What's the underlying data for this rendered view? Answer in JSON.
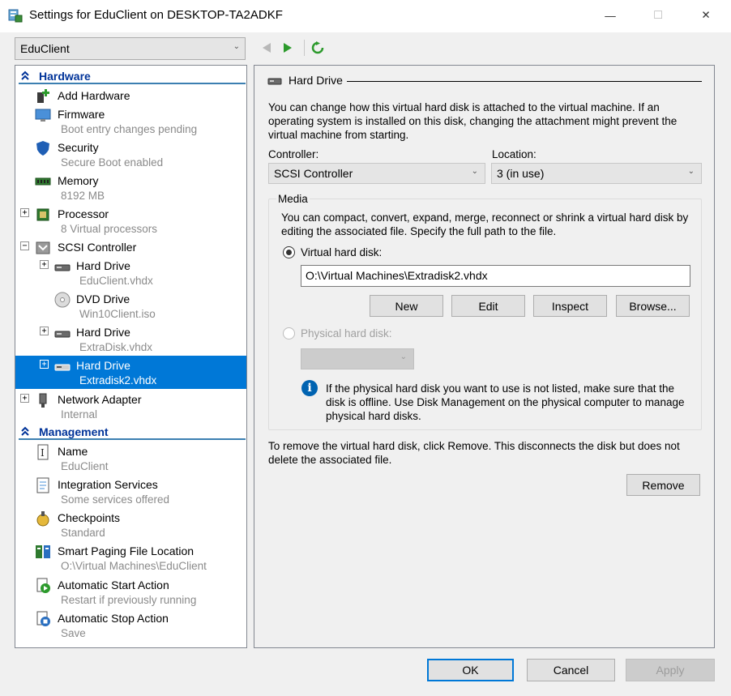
{
  "window": {
    "title": "Settings for EduClient on DESKTOP-TA2ADKF",
    "minimize": "—",
    "maximize": "☐",
    "close": "✕"
  },
  "vm_selector": {
    "value": "EduClient"
  },
  "toolbar": {
    "back": "◀",
    "forward": "▶",
    "refresh": "↻"
  },
  "tree": {
    "hardware_label": "Hardware",
    "management_label": "Management",
    "nodes": [
      {
        "label": "Add Hardware",
        "sub": "",
        "icon": "add-hardware-icon"
      },
      {
        "label": "Firmware",
        "sub": "Boot entry changes pending",
        "icon": "firmware-icon"
      },
      {
        "label": "Security",
        "sub": "Secure Boot enabled",
        "icon": "shield-icon"
      },
      {
        "label": "Memory",
        "sub": "8192 MB",
        "icon": "memory-icon"
      },
      {
        "label": "Processor",
        "sub": "8 Virtual processors",
        "icon": "processor-icon"
      },
      {
        "label": "SCSI Controller",
        "sub": "",
        "icon": "scsi-controller-icon"
      },
      {
        "label": "Hard Drive",
        "sub": "EduClient.vhdx",
        "icon": "hard-drive-icon"
      },
      {
        "label": "DVD Drive",
        "sub": "Win10Client.iso",
        "icon": "dvd-drive-icon"
      },
      {
        "label": "Hard Drive",
        "sub": "ExtraDisk.vhdx",
        "icon": "hard-drive-icon"
      },
      {
        "label": "Hard Drive",
        "sub": "Extradisk2.vhdx",
        "icon": "hard-drive-icon"
      },
      {
        "label": "Network Adapter",
        "sub": "Internal",
        "icon": "network-adapter-icon"
      },
      {
        "label": "Name",
        "sub": "EduClient",
        "icon": "name-icon"
      },
      {
        "label": "Integration Services",
        "sub": "Some services offered",
        "icon": "integration-services-icon"
      },
      {
        "label": "Checkpoints",
        "sub": "Standard",
        "icon": "checkpoints-icon"
      },
      {
        "label": "Smart Paging File Location",
        "sub": "O:\\Virtual Machines\\EduClient",
        "icon": "smart-paging-icon"
      },
      {
        "label": "Automatic Start Action",
        "sub": "Restart if previously running",
        "icon": "automatic-start-icon"
      },
      {
        "label": "Automatic Stop Action",
        "sub": "Save",
        "icon": "automatic-stop-icon"
      }
    ]
  },
  "panel": {
    "title": "Hard Drive",
    "intro": "You can change how this virtual hard disk is attached to the virtual machine. If an operating system is installed on this disk, changing the attachment might prevent the virtual machine from starting.",
    "controller_label": "Controller:",
    "controller_value": "SCSI Controller",
    "location_label": "Location:",
    "location_value": "3 (in use)",
    "media_label": "Media",
    "media_text": "You can compact, convert, expand, merge, reconnect or shrink a virtual hard disk by editing the associated file. Specify the full path to the file.",
    "vhd_label": "Virtual hard disk:",
    "vhd_path": "O:\\Virtual Machines\\Extradisk2.vhdx",
    "new_label": "New",
    "edit_label": "Edit",
    "inspect_label": "Inspect",
    "browse_label": "Browse...",
    "phys_label": "Physical hard disk:",
    "phys_info": "If the physical hard disk you want to use is not listed, make sure that the disk is offline. Use Disk Management on the physical computer to manage physical hard disks.",
    "remove_text": "To remove the virtual hard disk, click Remove. This disconnects the disk but does not delete the associated file.",
    "remove_label": "Remove"
  },
  "footer": {
    "ok_label": "OK",
    "cancel_label": "Cancel",
    "apply_label": "Apply"
  },
  "colors": {
    "selection": "#0078d7",
    "section": "#003399",
    "accent": "#0078d7"
  }
}
